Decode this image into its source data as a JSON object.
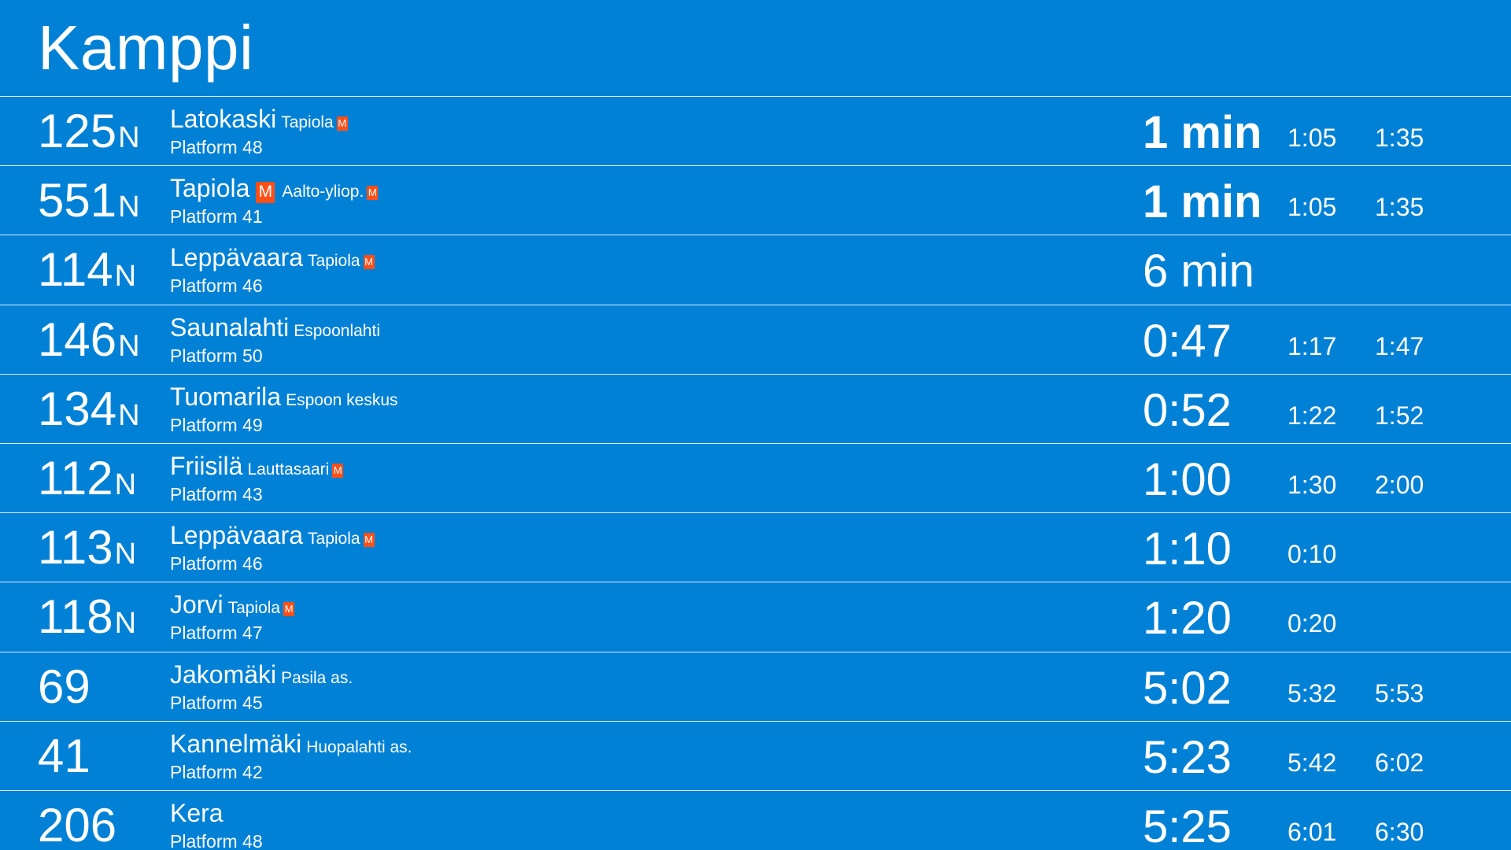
{
  "station": {
    "name": "Kamppi"
  },
  "colors": {
    "background": "#0181d6",
    "metro_badge": "#ff4f18",
    "text": "#ffffff"
  },
  "metro_badge_label": "M",
  "departures": [
    {
      "route": "125",
      "route_suffix": "N",
      "destination": "Latokaski",
      "destination_metro": false,
      "via": "Tapiola",
      "via_metro": true,
      "platform": "Platform 48",
      "next": "1 min",
      "next_bold": true,
      "following": [
        "1:05",
        "1:35"
      ]
    },
    {
      "route": "551",
      "route_suffix": "N",
      "destination": "Tapiola",
      "destination_metro": true,
      "via": "Aalto-yliop.",
      "via_metro": true,
      "platform": "Platform 41",
      "next": "1 min",
      "next_bold": true,
      "following": [
        "1:05",
        "1:35"
      ]
    },
    {
      "route": "114",
      "route_suffix": "N",
      "destination": "Leppävaara",
      "destination_metro": false,
      "via": "Tapiola",
      "via_metro": true,
      "platform": "Platform 46",
      "next": "6 min",
      "next_bold": false,
      "following": []
    },
    {
      "route": "146",
      "route_suffix": "N",
      "destination": "Saunalahti",
      "destination_metro": false,
      "via": "Espoonlahti",
      "via_metro": false,
      "platform": "Platform 50",
      "next": "0:47",
      "next_bold": false,
      "following": [
        "1:17",
        "1:47"
      ]
    },
    {
      "route": "134",
      "route_suffix": "N",
      "destination": "Tuomarila",
      "destination_metro": false,
      "via": "Espoon keskus",
      "via_metro": false,
      "platform": "Platform 49",
      "next": "0:52",
      "next_bold": false,
      "following": [
        "1:22",
        "1:52"
      ]
    },
    {
      "route": "112",
      "route_suffix": "N",
      "destination": "Friisilä",
      "destination_metro": false,
      "via": "Lauttasaari",
      "via_metro": true,
      "platform": "Platform 43",
      "next": "1:00",
      "next_bold": false,
      "following": [
        "1:30",
        "2:00"
      ]
    },
    {
      "route": "113",
      "route_suffix": "N",
      "destination": "Leppävaara",
      "destination_metro": false,
      "via": "Tapiola",
      "via_metro": true,
      "platform": "Platform 46",
      "next": "1:10",
      "next_bold": false,
      "following": [
        "0:10"
      ]
    },
    {
      "route": "118",
      "route_suffix": "N",
      "destination": "Jorvi",
      "destination_metro": false,
      "via": "Tapiola",
      "via_metro": true,
      "platform": "Platform 47",
      "next": "1:20",
      "next_bold": false,
      "following": [
        "0:20"
      ]
    },
    {
      "route": "69",
      "route_suffix": "",
      "destination": "Jakomäki",
      "destination_metro": false,
      "via": "Pasila as.",
      "via_metro": false,
      "platform": "Platform 45",
      "next": "5:02",
      "next_bold": false,
      "following": [
        "5:32",
        "5:53"
      ]
    },
    {
      "route": "41",
      "route_suffix": "",
      "destination": "Kannelmäki",
      "destination_metro": false,
      "via": "Huopalahti as.",
      "via_metro": false,
      "platform": "Platform 42",
      "next": "5:23",
      "next_bold": false,
      "following": [
        "5:42",
        "6:02"
      ]
    },
    {
      "route": "206",
      "route_suffix": "",
      "destination": "Kera",
      "destination_metro": false,
      "via": "",
      "via_metro": false,
      "platform": "Platform 48",
      "next": "5:25",
      "next_bold": false,
      "following": [
        "6:01",
        "6:30"
      ]
    }
  ]
}
